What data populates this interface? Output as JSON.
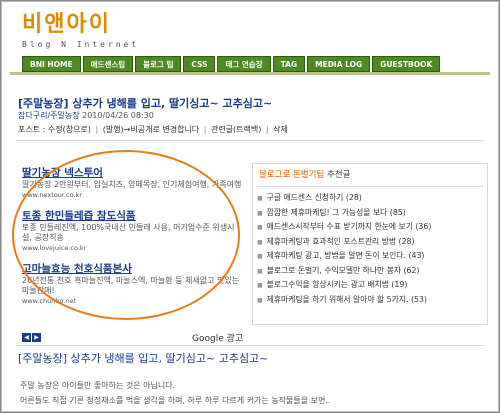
{
  "logo": {
    "text": "비앤아이",
    "tagline": "Blog N Internet"
  },
  "nav": [
    "BNI HOME",
    "애드센스팁",
    "블로그 팁",
    "CSS",
    "태그 연습장",
    "TAG",
    "MEDIA LOG",
    "GUESTBOOK"
  ],
  "post": {
    "title": "[주말농장] 상추가 냉해를 입고, 딸기싱고~ 고추심고~",
    "category": "잡다구리/주말농장",
    "date": "2010/04/26 08:30",
    "ops": {
      "modify": "수정/삭제",
      "label_prefix": "포스트 :",
      "open_state": "수정(창으로)",
      "change": "(발행)→비공개로 변경합니다",
      "trackback": "관련글(트랙백)",
      "delete": "삭제"
    }
  },
  "ads": [
    {
      "title": "딸기농장 넥스투어",
      "desc": "딸기농장 2만원부터, 입실치즈, 양떼목장, 인기체험여행, 가족여행",
      "url": "www.nextour.co.kr"
    },
    {
      "title": "토종 한민들레즙 참도식품",
      "desc": "토종 민들레진액, 100%국내산 민들레 사용, 머기업수준 위생시설, 공장직송",
      "url": "www.lovejuice.co.kr"
    },
    {
      "title": "고마늘효능 천호식품본사",
      "desc": "26년전통 천호 흑마늘진액, 마늘스엑, 마늘환 등 체새없고 맛있는 마늘판매!",
      "url": "www.chunho.net"
    }
  ],
  "google_label": "Google 광고",
  "sidebar": {
    "title_highlight": "블로그로 돈벌기팁",
    "title_suffix": "추천글",
    "items": [
      {
        "text": "구글 애드센스 신청하기",
        "count": "(28)"
      },
      {
        "text": "깜깜한 제휴마케팅! 그 가능성을 보다",
        "count": "(85)"
      },
      {
        "text": "애드센스시작부터 수표 받기까지 한눈에 보기",
        "count": "(36)"
      },
      {
        "text": "제휴마케팅과 효과적인 포스트관리 방법",
        "count": "(28)"
      },
      {
        "text": "제휴마케팅 광고, 방법을 알면 돈이 보인다.",
        "count": "(43)"
      },
      {
        "text": "블로그로 돈벌기, 수익모델만 하나만 봉자",
        "count": "(62)"
      },
      {
        "text": "블로그수익을 향상시키는 광고 배치법",
        "count": "(19)"
      },
      {
        "text": "제휴마케팅을 하기 위해서 알아야 할 5가지.",
        "count": "(53)"
      }
    ]
  },
  "post2": {
    "title": "[주말농장] 상추가 냉해를 입고, 딸기심고~ 고추심고~",
    "line1": "주말 농장은 아이들만 좋아하는 것은 아닙니다.",
    "line2": "어른들도 직접 기른 청정채소를 먹을 생각을 하며, 하루 하루 다르게 커가는 농작물들을 보면.."
  },
  "colors": {
    "nav_green": "#4e8a22",
    "link_blue": "#1a3a8a",
    "highlight_orange": "#f07a16"
  }
}
